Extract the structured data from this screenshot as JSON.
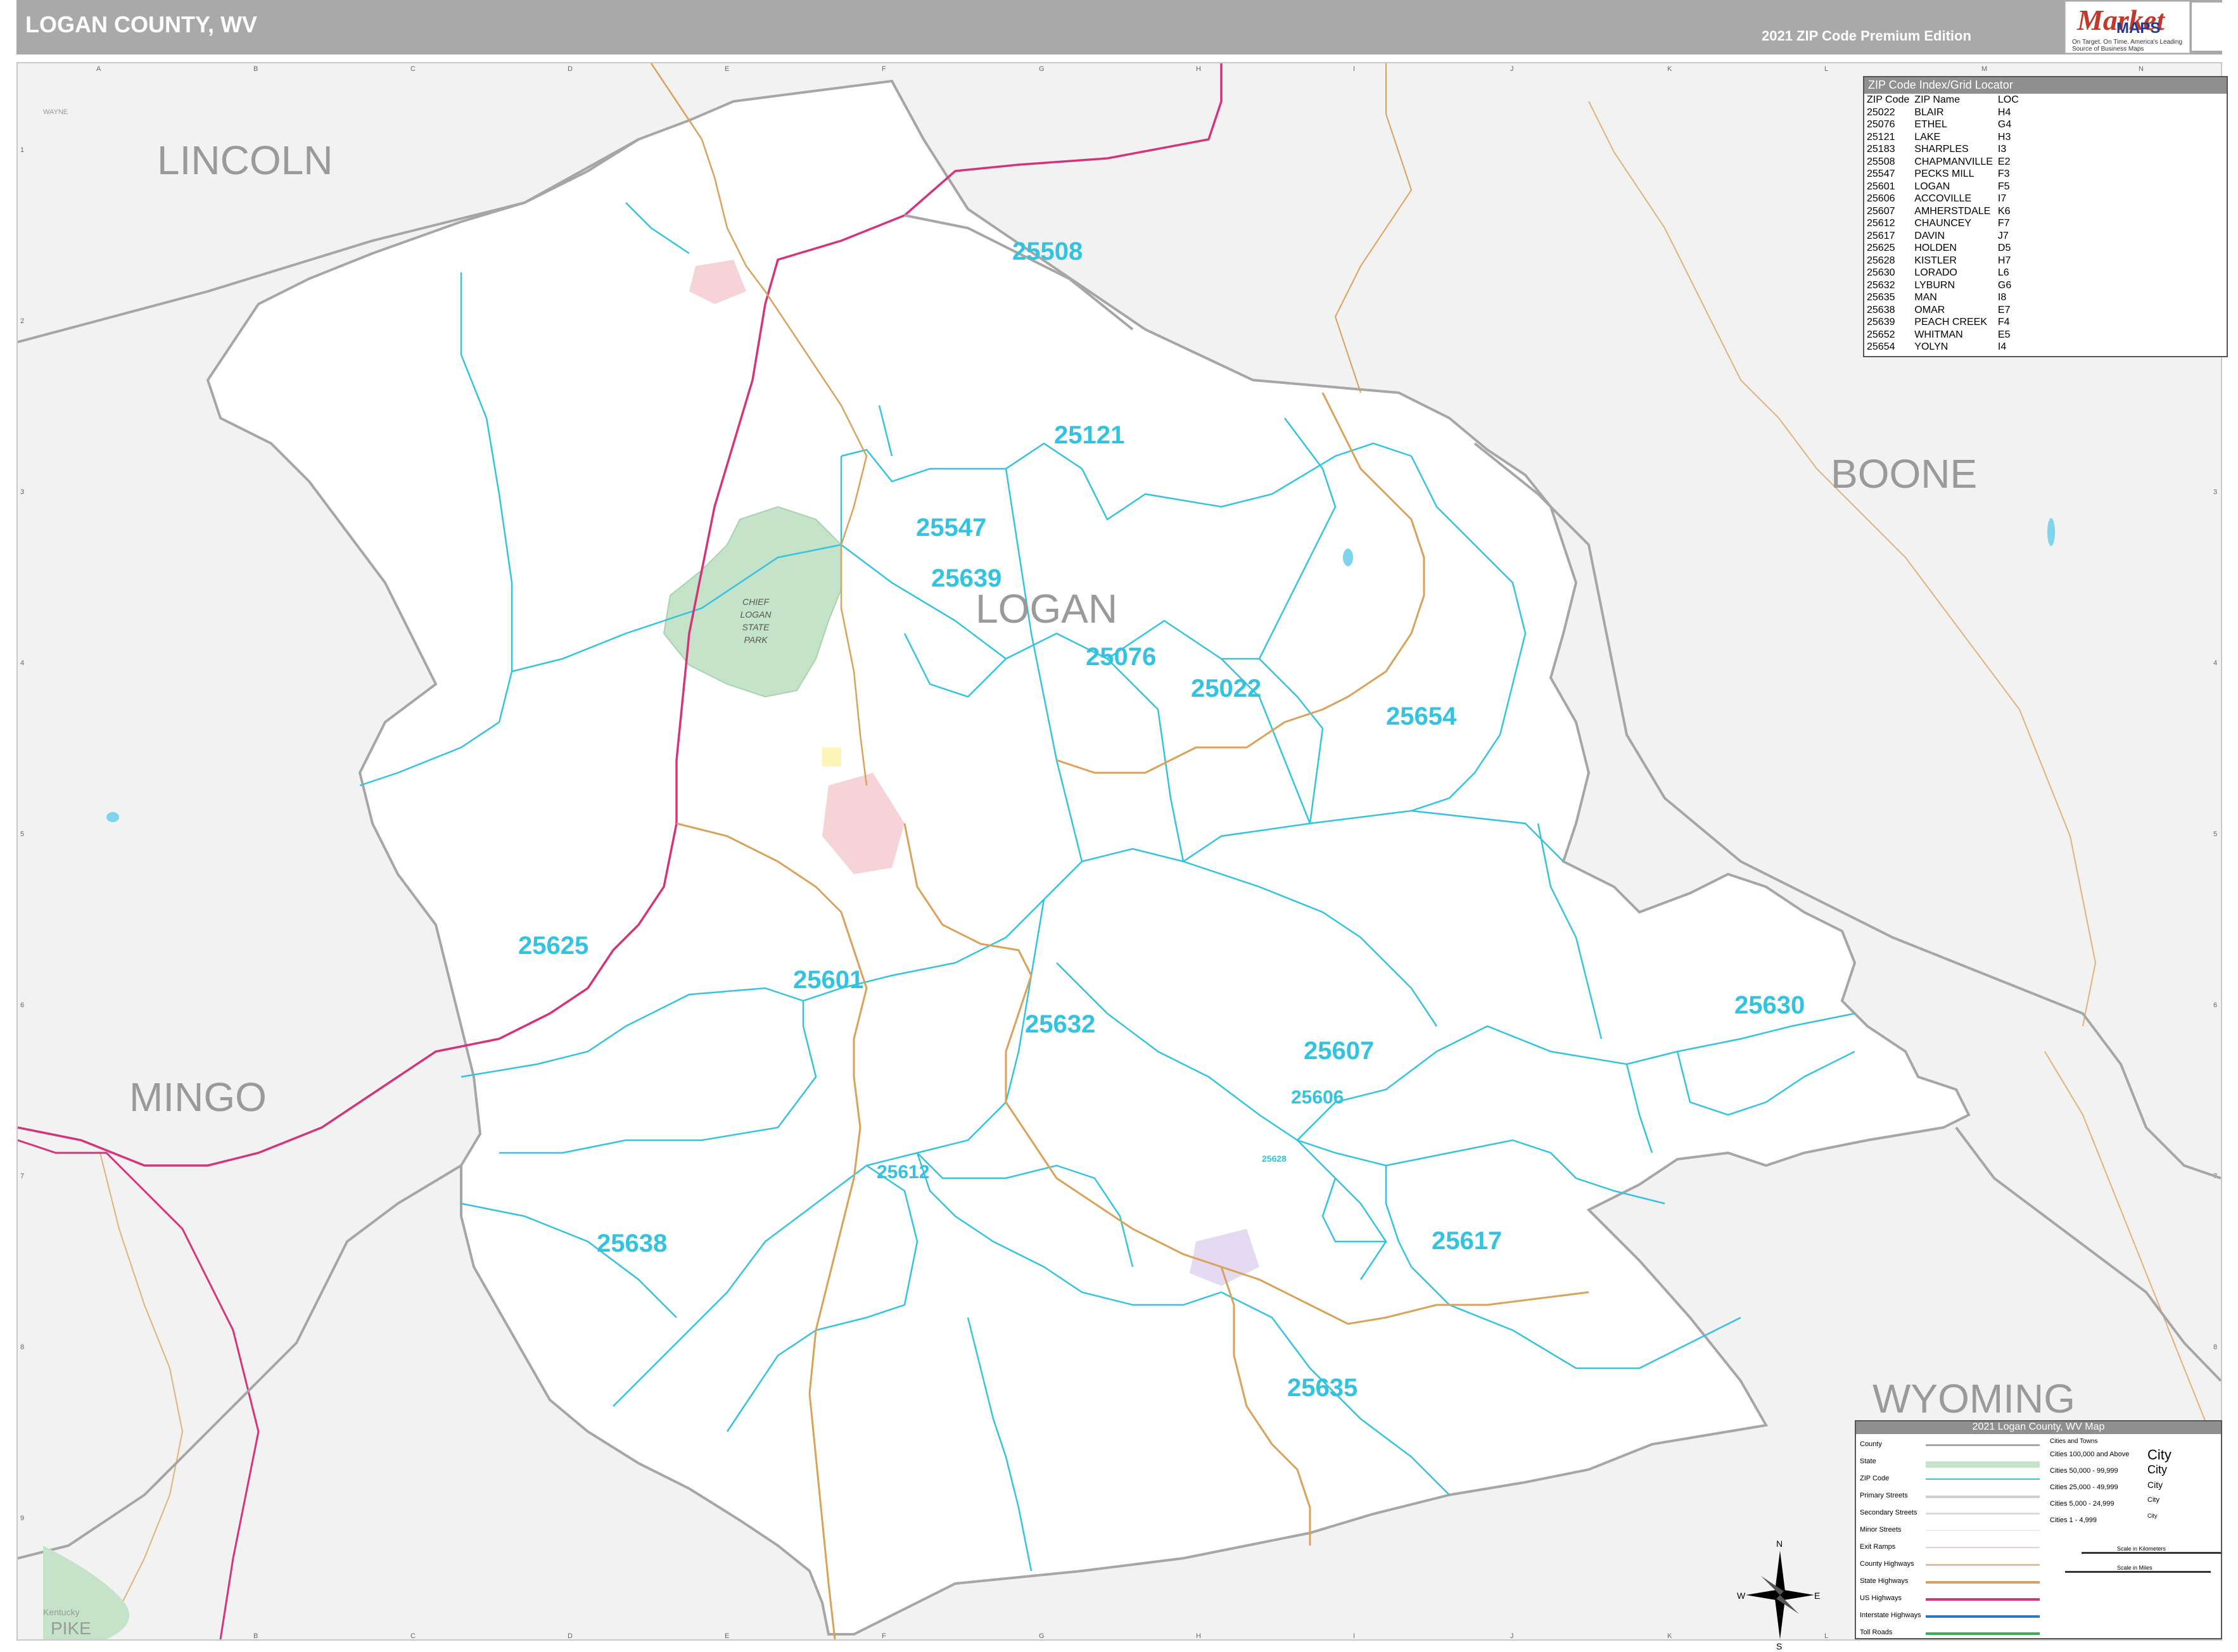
{
  "header": {
    "title": "LOGAN COUNTY, WV",
    "edition": "2021 ZIP Code Premium Edition",
    "logo_text_1": "Market",
    "logo_text_2": "MAPS",
    "logo_tagline": "On Target. On Time. America's Leading Source of Business Maps"
  },
  "colors": {
    "zip_boundary": "#33c3e0",
    "county_boundary": "#a6a6a6",
    "park": "#c4e3c8",
    "us_highway": "#d6337a",
    "state_highway": "#d9a25a",
    "zip_label": "#33c3e0",
    "county_label": "#9a9a9a"
  },
  "grid": {
    "columns": [
      "A",
      "B",
      "C",
      "D",
      "E",
      "F",
      "G",
      "H",
      "I",
      "J",
      "K",
      "L",
      "M",
      "N"
    ],
    "rows": [
      "1",
      "2",
      "3",
      "4",
      "5",
      "6",
      "7",
      "8",
      "9"
    ]
  },
  "counties": {
    "lincoln": "LINCOLN",
    "logan": "LOGAN",
    "boone": "BOONE",
    "mingo": "MINGO",
    "wyoming": "WYOMING",
    "pike": "PIKE",
    "kentucky": "Kentucky",
    "wayne": "WAYNE"
  },
  "park": {
    "name_1": "CHIEF",
    "name_2": "LOGAN",
    "name_3": "STATE",
    "name_4": "PARK"
  },
  "zip_labels": {
    "z25508": "25508",
    "z25121": "25121",
    "z25547": "25547",
    "z25639": "25639",
    "z25076": "25076",
    "z25022": "25022",
    "z25654": "25654",
    "z25625": "25625",
    "z25601": "25601",
    "z25632": "25632",
    "z25607": "25607",
    "z25606": "25606",
    "z25630": "25630",
    "z25612": "25612",
    "z25628": "25628",
    "z25638": "25638",
    "z25617": "25617",
    "z25635": "25635"
  },
  "zip_index": {
    "title": "ZIP Code Index/Grid Locator",
    "columns": [
      "ZIP Code",
      "ZIP Name",
      "LOC"
    ],
    "rows": [
      [
        "25022",
        "BLAIR",
        "H4"
      ],
      [
        "25076",
        "ETHEL",
        "G4"
      ],
      [
        "25121",
        "LAKE",
        "H3"
      ],
      [
        "25183",
        "SHARPLES",
        "I3"
      ],
      [
        "25508",
        "CHAPMANVILLE",
        "E2"
      ],
      [
        "25547",
        "PECKS MILL",
        "F3"
      ],
      [
        "25601",
        "LOGAN",
        "F5"
      ],
      [
        "25606",
        "ACCOVILLE",
        "I7"
      ],
      [
        "25607",
        "AMHERSTDALE",
        "K6"
      ],
      [
        "25612",
        "CHAUNCEY",
        "F7"
      ],
      [
        "25617",
        "DAVIN",
        "J7"
      ],
      [
        "25625",
        "HOLDEN",
        "D5"
      ],
      [
        "25628",
        "KISTLER",
        "H7"
      ],
      [
        "25630",
        "LORADO",
        "L6"
      ],
      [
        "25632",
        "LYBURN",
        "G6"
      ],
      [
        "25635",
        "MAN",
        "I8"
      ],
      [
        "25638",
        "OMAR",
        "E7"
      ],
      [
        "25639",
        "PEACH CREEK",
        "F4"
      ],
      [
        "25652",
        "WHITMAN",
        "E5"
      ],
      [
        "25654",
        "YOLYN",
        "I4"
      ]
    ]
  },
  "legend": {
    "title": "2021 Logan County, WV Map",
    "features": [
      "County",
      "State",
      "ZIP Code",
      "Primary Streets",
      "Secondary Streets",
      "Minor Streets",
      "Exit Ramps",
      "County Highways",
      "State Highways",
      "US Highways",
      "Interstate Highways",
      "Toll Roads"
    ],
    "cities_header": "Cities and Towns",
    "city_classes": [
      "Cities 100,000 and Above",
      "Cities 50,000 - 99,999",
      "Cities 25,000 - 49,999",
      "Cities 5,000 - 24,999",
      "Cities 1 - 4,999"
    ],
    "city_symbol": "City",
    "scale_km": "Scale in Kilometers",
    "scale_mi": "Scale in Miles"
  },
  "compass": {
    "n": "N",
    "s": "S",
    "e": "E",
    "w": "W"
  }
}
